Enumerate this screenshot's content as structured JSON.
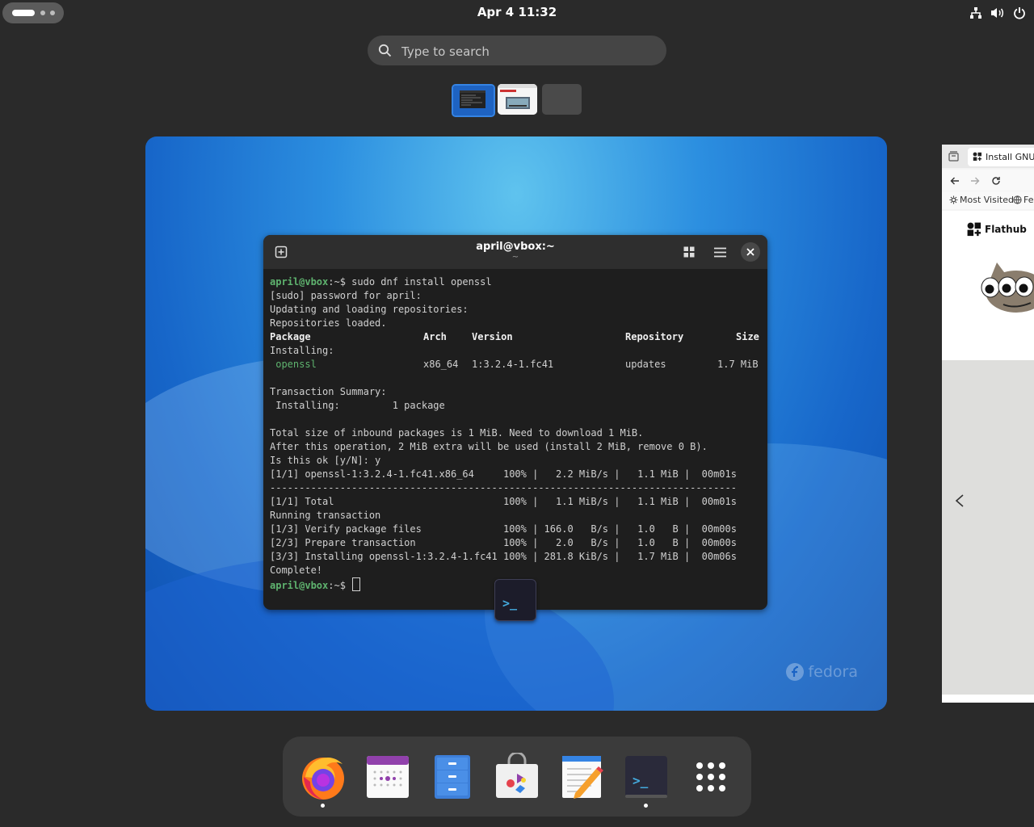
{
  "topbar": {
    "clock": "Apr 4  11:32",
    "tray_icons": [
      "network-icon",
      "volume-icon",
      "power-icon"
    ]
  },
  "search": {
    "placeholder": "Type to search"
  },
  "workspaces": {
    "count": 3,
    "active_index": 0
  },
  "terminal": {
    "title": "april@vbox:~",
    "subtitle": "~",
    "prompt_user": "april@vbox",
    "prompt_suffix": ":~$ ",
    "command": "sudo dnf install openssl",
    "lines": {
      "l1": "[sudo] password for april:",
      "l2": "Updating and loading repositories:",
      "l3": "Repositories loaded.",
      "h_package": "Package",
      "h_arch": "Arch",
      "h_version": "Version",
      "h_repo": "Repository",
      "h_size": "Size",
      "installing_hdr": "Installing:",
      "pkg_name": " openssl",
      "pkg_arch": "x86_64",
      "pkg_version": "1:3.2.4-1.fc41",
      "pkg_repo": "updates",
      "pkg_size": "1.7 MiB",
      "ts": "Transaction Summary:",
      "ts_installing": " Installing:         1 package",
      "total1": "Total size of inbound packages is 1 MiB. Need to download 1 MiB.",
      "total2": "After this operation, 2 MiB extra will be used (install 2 MiB, remove 0 B).",
      "confirm": "Is this ok [y/N]: y",
      "dl": "[1/1] openssl-1:3.2.4-1.fc41.x86_64     100% |   2.2 MiB/s |   1.1 MiB |  00m01s",
      "sep": "--------------------------------------------------------------------------------",
      "total": "[1/1] Total                             100% |   1.1 MiB/s |   1.1 MiB |  00m01s",
      "running": "Running transaction",
      "s1": "[1/3] Verify package files              100% | 166.0   B/s |   1.0   B |  00m00s",
      "s2": "[2/3] Prepare transaction               100% |   2.0   B/s |   1.0   B |  00m00s",
      "s3": "[3/3] Installing openssl-1:3.2.4-1.fc41 100% | 281.8 KiB/s |   1.7 MiB |  00m06s",
      "complete": "Complete!"
    }
  },
  "wallpaper": {
    "logo_text": "fedora"
  },
  "side_window": {
    "tab_title": "Install GNU Ir",
    "bookmark1": "Most Visited",
    "bookmark2": "Fe",
    "site_name": "Flathub"
  },
  "dash": {
    "apps": [
      {
        "name": "Firefox",
        "running": true
      },
      {
        "name": "Calendar",
        "running": false
      },
      {
        "name": "Files",
        "running": false
      },
      {
        "name": "Software",
        "running": false
      },
      {
        "name": "Text Editor",
        "running": false
      },
      {
        "name": "Terminal",
        "running": true
      },
      {
        "name": "Show Apps",
        "running": false
      }
    ]
  },
  "colors": {
    "accent": "#3584e4",
    "terminal_bg": "#1e1e1e",
    "prompt_green": "#5fb46f",
    "shell_bg": "#2a2a2a"
  }
}
